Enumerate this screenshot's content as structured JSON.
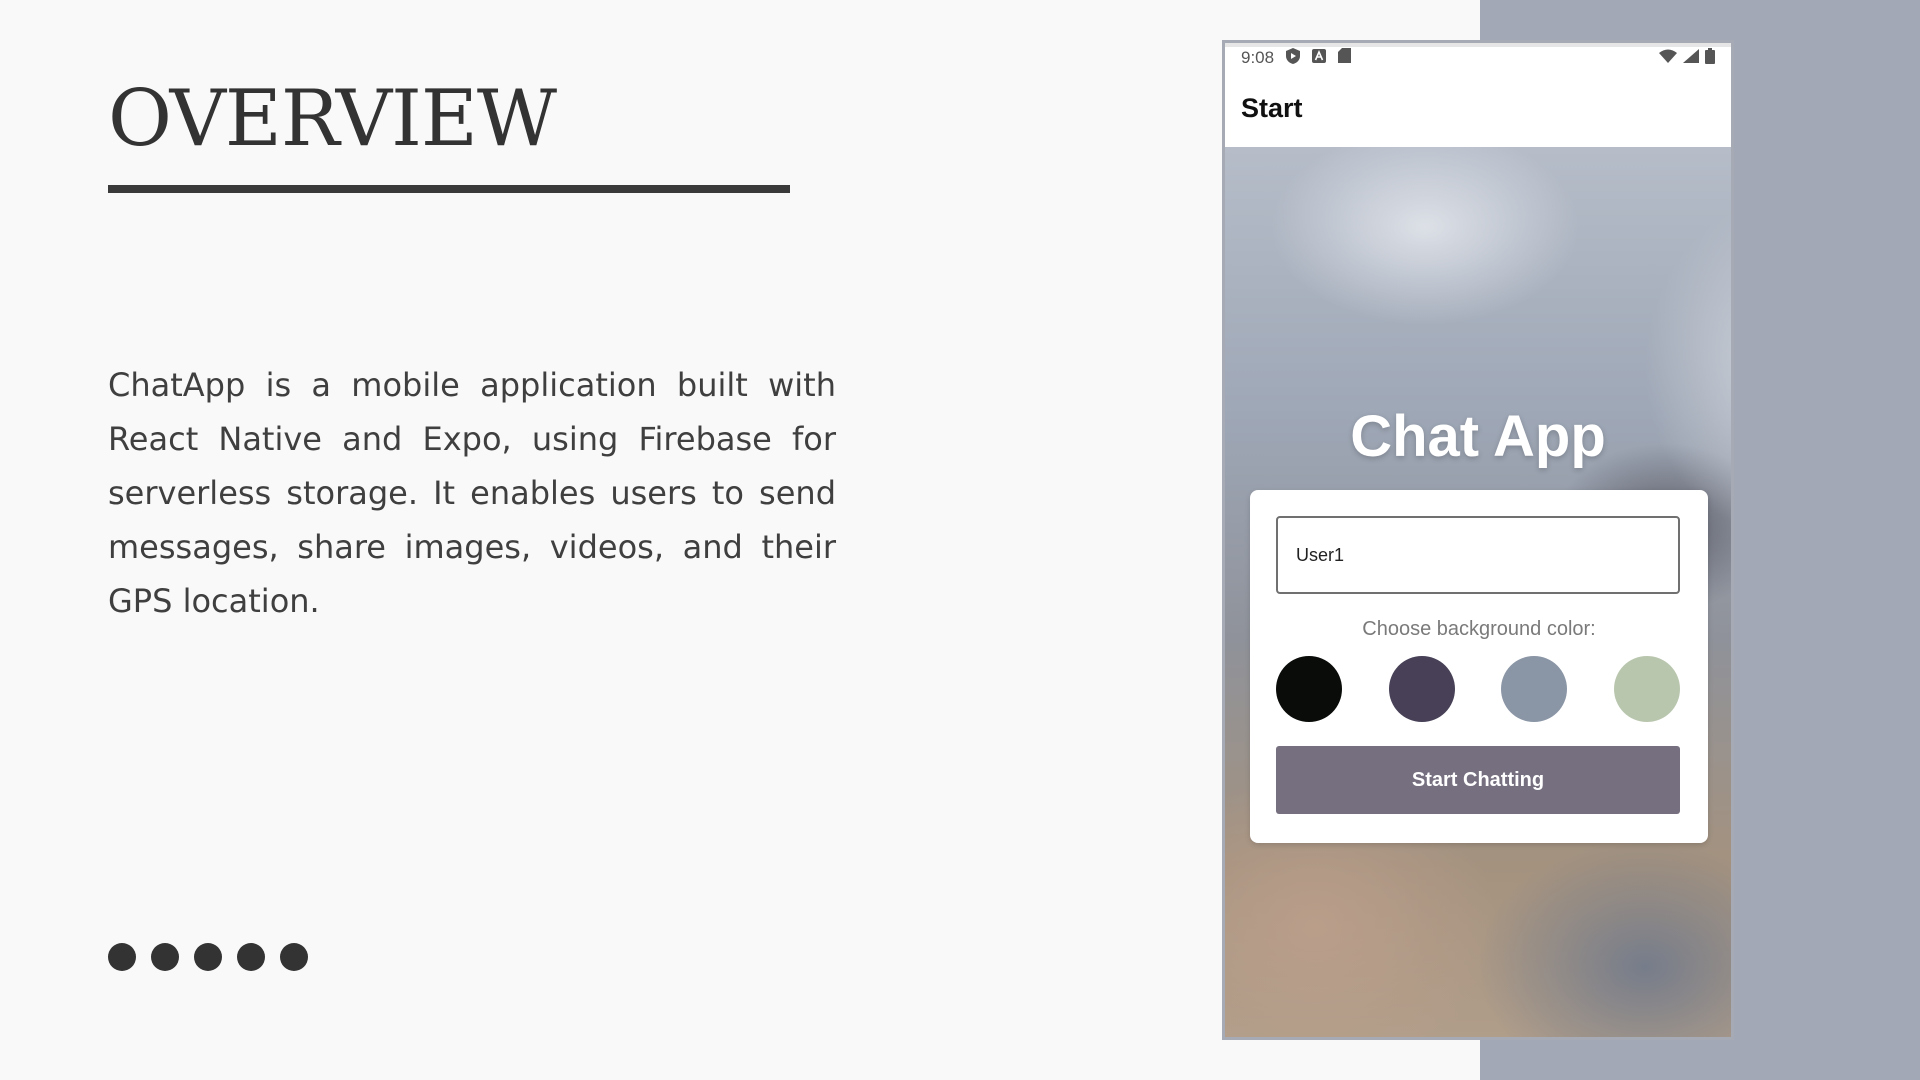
{
  "slide": {
    "title": "OVERVIEW",
    "description": "ChatApp is a mobile application built with React Native and Expo, using Firebase for serverless storage. It enables users to send messages, share images, videos, and their GPS location.",
    "dot_count": 5,
    "right_panel_color": "#a2a8b6"
  },
  "phone": {
    "status_bar": {
      "time": "9:08",
      "left_icons": [
        "shield-play-icon",
        "a-badge-icon",
        "sd-card-icon"
      ],
      "right_icons": [
        "wifi-icon",
        "signal-icon",
        "battery-icon"
      ]
    },
    "app_bar": {
      "title": "Start"
    },
    "app_title": "Chat App",
    "form": {
      "name_value": "User1",
      "choose_label": "Choose background color:",
      "colors": [
        "#090c08",
        "#474056",
        "#8a95a5",
        "#b9c6ae"
      ],
      "button_label": "Start Chatting",
      "button_color": "#766f80"
    }
  }
}
